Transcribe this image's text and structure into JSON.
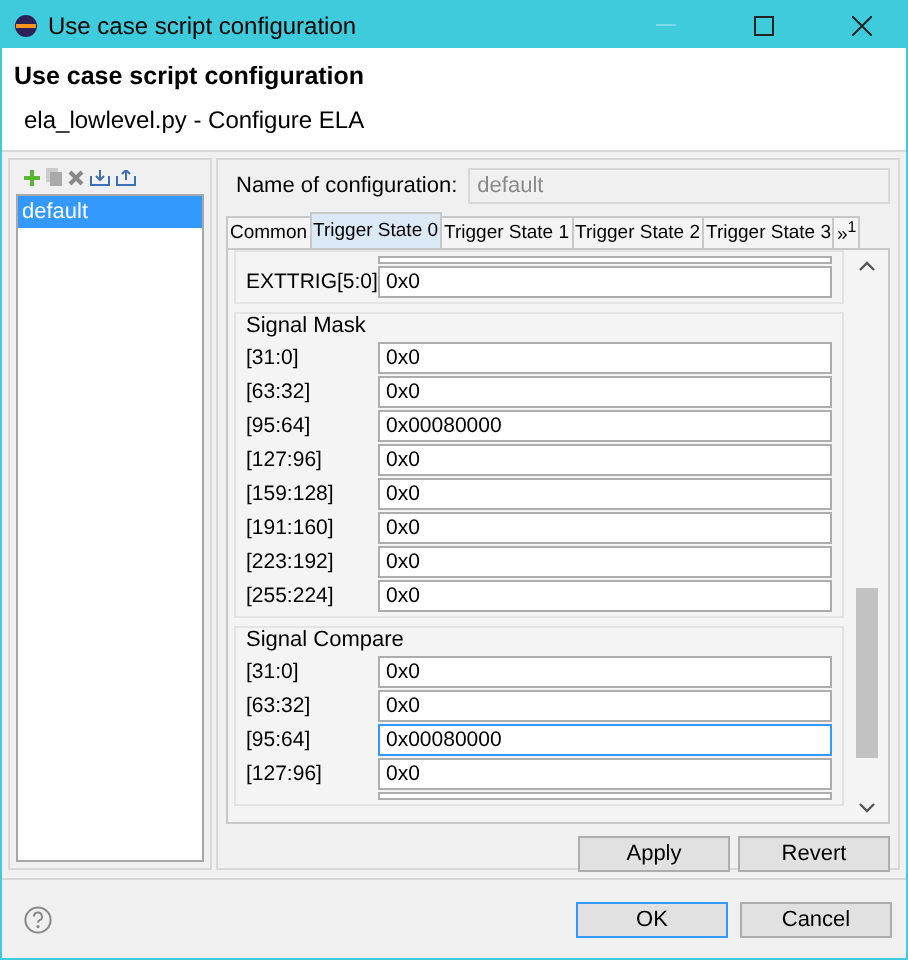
{
  "window": {
    "title": "Use case script configuration"
  },
  "header": {
    "title": "Use case script configuration",
    "subtitle": "ela_lowlevel.py - Configure ELA"
  },
  "configurations": [
    {
      "label": "default",
      "selected": true
    }
  ],
  "name_field": {
    "label": "Name of configuration:",
    "value": "default",
    "disabled": true
  },
  "tabs": [
    {
      "label": "Common",
      "selected": false
    },
    {
      "label": "Trigger State 0",
      "selected": true
    },
    {
      "label": "Trigger State 1",
      "selected": false
    },
    {
      "label": "Trigger State 2",
      "selected": false
    },
    {
      "label": "Trigger State 3",
      "selected": false
    },
    {
      "label": "»$^{1}$"
    }
  ],
  "groups": [
    {
      "cut_top": true,
      "rows": [
        {
          "label": "EXTTRIG[5:0]",
          "value": "0x0",
          "focused": false
        }
      ]
    },
    {
      "title": "Signal Mask",
      "rows": [
        {
          "label": "[31:0]",
          "value": "0x0",
          "focused": false
        },
        {
          "label": "[63:32]",
          "value": "0x0",
          "focused": false
        },
        {
          "label": "[95:64]",
          "value": "0x00080000",
          "focused": false
        },
        {
          "label": "[127:96]",
          "value": "0x0",
          "focused": false
        },
        {
          "label": "[159:128]",
          "value": "0x0",
          "focused": false
        },
        {
          "label": "[191:160]",
          "value": "0x0",
          "focused": false
        },
        {
          "label": "[223:192]",
          "value": "0x0",
          "focused": false
        },
        {
          "label": "[255:224]",
          "value": "0x0",
          "focused": false
        }
      ]
    },
    {
      "title": "Signal Compare",
      "cut_bottom": true,
      "rows": [
        {
          "label": "[31:0]",
          "value": "0x0",
          "focused": false
        },
        {
          "label": "[63:32]",
          "value": "0x0",
          "focused": false
        },
        {
          "label": "[95:64]",
          "value": "0x00080000",
          "focused": true
        },
        {
          "label": "[127:96]",
          "value": "0x0",
          "focused": false
        }
      ]
    }
  ],
  "panel_buttons": [
    "Apply",
    "Revert"
  ],
  "dialog_buttons": [
    {
      "label": "OK",
      "default": true
    },
    {
      "label": "Cancel",
      "default": false
    }
  ]
}
